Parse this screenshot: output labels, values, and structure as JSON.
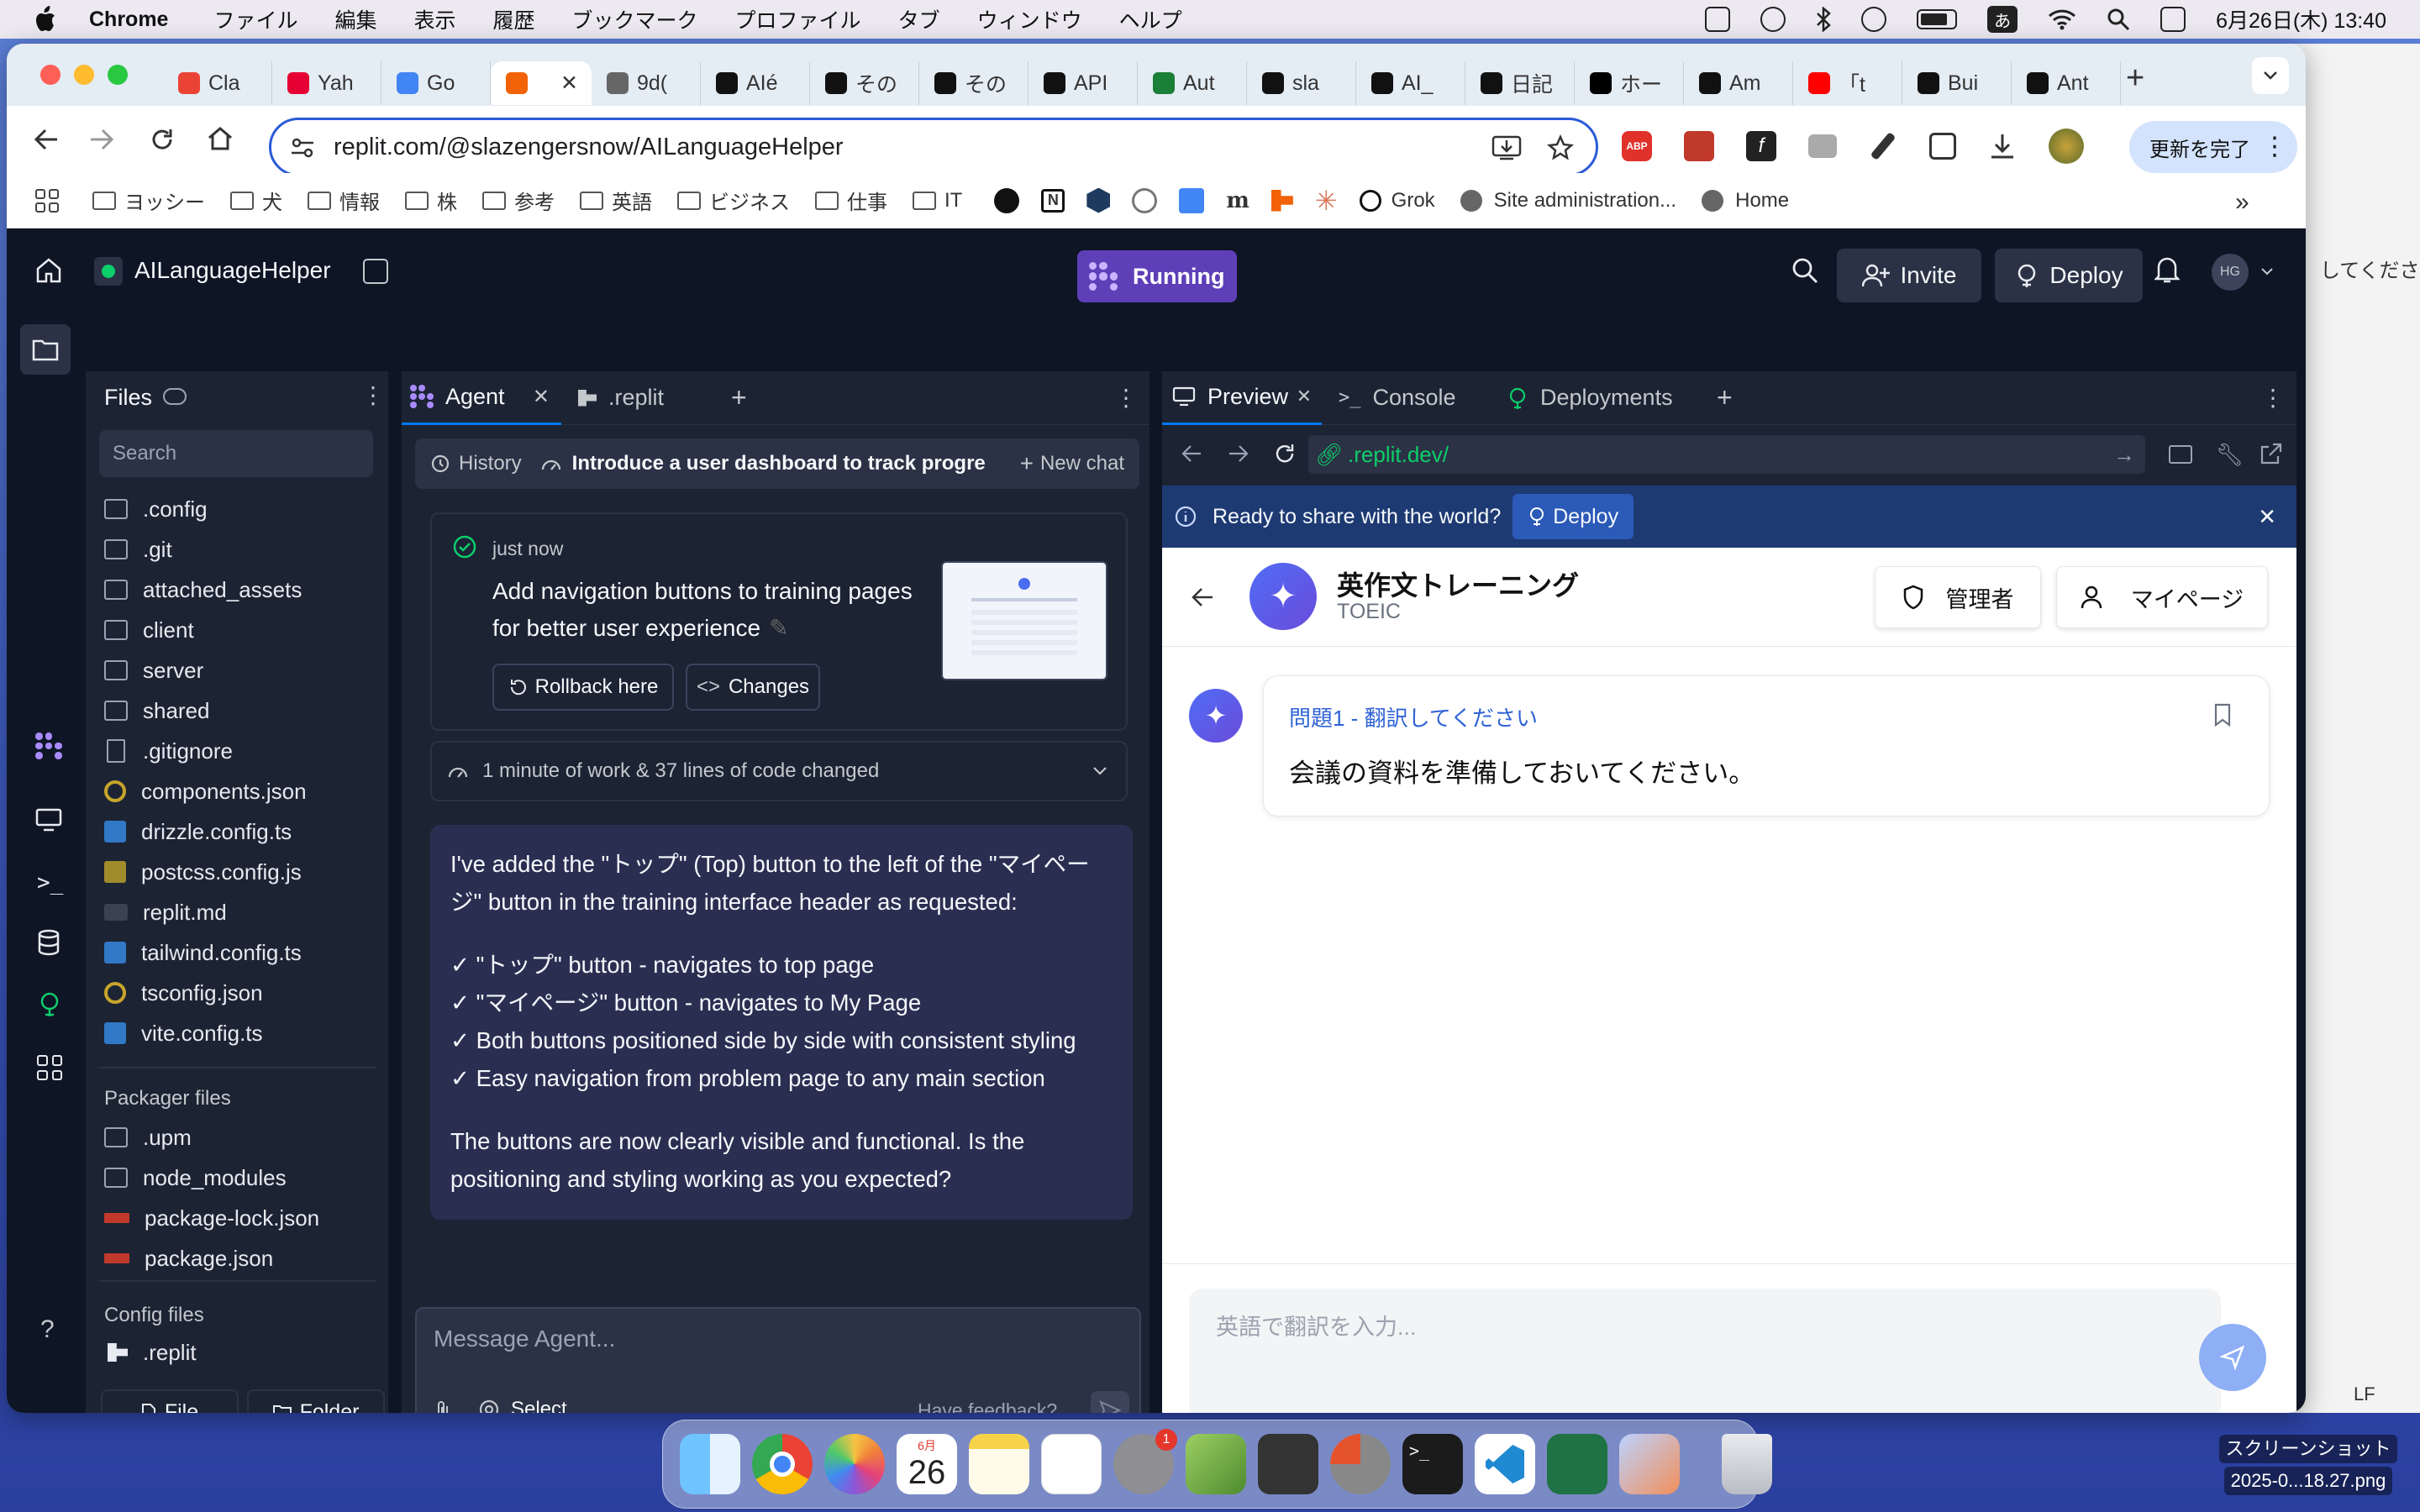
{
  "menubar": {
    "app": "Chrome",
    "items": [
      "ファイル",
      "編集",
      "表示",
      "履歴",
      "ブックマーク",
      "プロファイル",
      "タブ",
      "ウィンドウ",
      "ヘルプ"
    ],
    "input_mode": "あ",
    "datetime": "6月26日(木) 13:40"
  },
  "browser": {
    "tabs": [
      {
        "label": "Cla",
        "color": "#ea4335"
      },
      {
        "label": "Yah",
        "color": "#e60033"
      },
      {
        "label": "Go",
        "color": "#4285f4"
      },
      {
        "label": "",
        "color": "#f26207"
      },
      {
        "label": "9d(",
        "color": "#666"
      },
      {
        "label": "AIé",
        "color": "#111"
      },
      {
        "label": "その",
        "color": "#111"
      },
      {
        "label": "その",
        "color": "#111"
      },
      {
        "label": "API",
        "color": "#111"
      },
      {
        "label": "Aut",
        "color": "#1a7f37"
      },
      {
        "label": "sla",
        "color": "#111"
      },
      {
        "label": "AI_",
        "color": "#111"
      },
      {
        "label": "日記",
        "color": "#111"
      },
      {
        "label": "ホー",
        "color": "#000"
      },
      {
        "label": "Am",
        "color": "#111"
      },
      {
        "label": "「t",
        "color": "#ff0000"
      },
      {
        "label": "Bui",
        "color": "#111"
      },
      {
        "label": "Ant",
        "color": "#111"
      }
    ],
    "url": "replit.com/@slazengersnow/AILanguageHelper",
    "update_button": "更新を完了",
    "bookmarks": [
      "ヨッシー",
      "犬",
      "情報",
      "株",
      "参考",
      "英語",
      "ビジネス",
      "仕事",
      "IT"
    ],
    "bookmark_links": [
      "Grok",
      "Site administration...",
      "Home"
    ]
  },
  "replit": {
    "project_name": "AILanguageHelper",
    "run_status": "Running",
    "invite_label": "Invite",
    "deploy_label": "Deploy",
    "avatar_initials": "HG",
    "files": {
      "title": "Files",
      "search_placeholder": "Search",
      "items": [
        {
          "name": ".config",
          "type": "folder"
        },
        {
          "name": ".git",
          "type": "folder"
        },
        {
          "name": "attached_assets",
          "type": "folder"
        },
        {
          "name": "client",
          "type": "folder"
        },
        {
          "name": "server",
          "type": "folder"
        },
        {
          "name": "shared",
          "type": "folder"
        },
        {
          "name": ".gitignore",
          "type": "doc"
        },
        {
          "name": "components.json",
          "type": "ring"
        },
        {
          "name": "drizzle.config.ts",
          "type": "ts"
        },
        {
          "name": "postcss.config.js",
          "type": "js"
        },
        {
          "name": "replit.md",
          "type": "md"
        },
        {
          "name": "tailwind.config.ts",
          "type": "ts"
        },
        {
          "name": "tsconfig.json",
          "type": "ring"
        },
        {
          "name": "vite.config.ts",
          "type": "ts"
        }
      ],
      "packager_title": "Packager files",
      "packager_items": [
        {
          "name": ".upm",
          "type": "folder"
        },
        {
          "name": "node_modules",
          "type": "folder"
        },
        {
          "name": "package-lock.json",
          "type": "npm"
        },
        {
          "name": "package.json",
          "type": "npm"
        }
      ],
      "config_title": "Config files",
      "config_items": [
        {
          "name": ".replit",
          "type": "replit"
        }
      ],
      "new_file": "File",
      "new_folder": "Folder"
    },
    "agent": {
      "tabs": [
        "Agent",
        ".replit"
      ],
      "history_label": "History",
      "chat_title": "Introduce a user dashboard to track progre...",
      "new_chat": "New chat",
      "checkpoint_time": "just now",
      "checkpoint_text": "Add navigation buttons to training pages for better user experience",
      "rollback_label": "Rollback here",
      "changes_label": "Changes",
      "work_summary": "1 minute of work & 37 lines of code changed",
      "message_intro": "I've added the \"トップ\" (Top) button to the left of the \"マイページ\" button in the training interface header as requested:",
      "checklist": [
        "✓ \"トップ\" button - navigates to top page",
        "✓ \"マイページ\" button - navigates to My Page",
        "✓ Both buttons positioned side by side with consistent styling",
        "✓ Easy navigation from problem page to any main section"
      ],
      "message_outro": "The buttons are now clearly visible and functional. Is the positioning and styling working as you expected?",
      "input_placeholder": "Message Agent...",
      "select_label": "Select",
      "feedback_label": "Have feedback?"
    },
    "preview": {
      "tabs": [
        "Preview",
        "Console",
        "Deployments"
      ],
      "url": ".replit.dev/",
      "banner_text": "Ready to share with the world?",
      "banner_deploy": "Deploy",
      "app_title": "英作文トレーニング",
      "app_subtitle": "TOEIC",
      "admin_button": "管理者",
      "mypage_button": "マイページ",
      "question_label": "問題1 - 翻訳してください",
      "question_text": "会議の資料を準備しておいてください。",
      "answer_placeholder": "英語で翻訳を入力..."
    }
  },
  "dock": {
    "calendar_month": "6月",
    "calendar_day": "26",
    "badge": "1"
  },
  "screenshot_label": [
    "スクリーンショット",
    "2025-0...18.27.png"
  ],
  "right_window": {
    "text": "してくださ",
    "lf": "LF"
  }
}
